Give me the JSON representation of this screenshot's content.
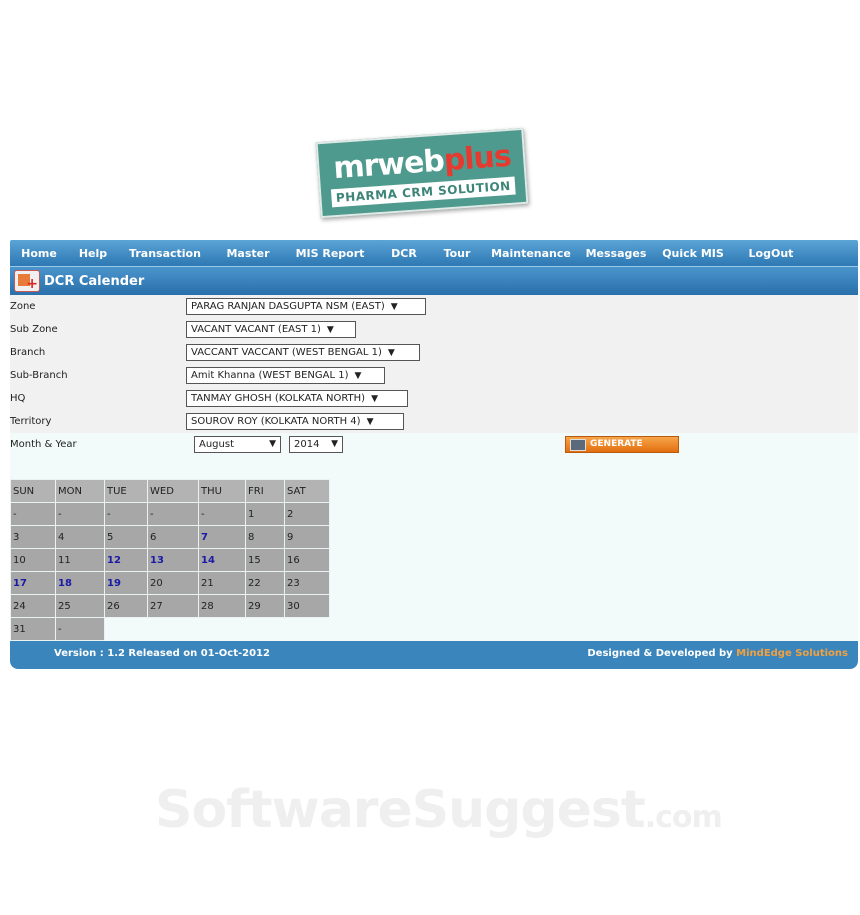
{
  "logo": {
    "word_main": "mrweb",
    "word_accent": "plus",
    "tagline": "PHARMA CRM SOLUTION"
  },
  "nav": [
    "Home",
    "Help",
    "Transaction",
    "Master",
    "MIS Report",
    "DCR",
    "Tour",
    "Maintenance",
    "Messages",
    "Quick MIS",
    "LogOut"
  ],
  "page_title": "DCR Calender",
  "form": {
    "zone": {
      "label": "Zone",
      "value": "PARAG RANJAN DASGUPTA NSM (EAST)"
    },
    "sub_zone": {
      "label": "Sub Zone",
      "value": "VACANT VACANT (EAST 1)"
    },
    "branch": {
      "label": "Branch",
      "value": "VACCANT VACCANT (WEST BENGAL 1)"
    },
    "sub_branch": {
      "label": "Sub-Branch",
      "value": "Amit Khanna (WEST BENGAL 1)"
    },
    "hq": {
      "label": "HQ",
      "value": "TANMAY GHOSH (KOLKATA NORTH)"
    },
    "territory": {
      "label": "Territory",
      "value": "SOUROV ROY (KOLKATA NORTH 4)"
    },
    "month_year": {
      "label": "Month & Year",
      "month": "August",
      "year": "2014"
    },
    "generate_label": "GENERATE",
    "arrow": "▼"
  },
  "calendar": {
    "headers": [
      "SUN",
      "MON",
      "TUE",
      "WED",
      "THU",
      "FRI",
      "SAT"
    ],
    "weeks": [
      [
        "-",
        "-",
        "-",
        "-",
        "-",
        "1",
        "2"
      ],
      [
        "3",
        "4",
        "5",
        "6",
        "7",
        "8",
        "9"
      ],
      [
        "10",
        "11",
        "12",
        "13",
        "14",
        "15",
        "16"
      ],
      [
        "17",
        "18",
        "19",
        "20",
        "21",
        "22",
        "23"
      ],
      [
        "24",
        "25",
        "26",
        "27",
        "28",
        "29",
        "30"
      ],
      [
        "31",
        "-"
      ]
    ],
    "highlighted": [
      "7",
      "12",
      "13",
      "14",
      "17",
      "18",
      "19"
    ],
    "highlight_color": "#1a1aa6"
  },
  "footer": {
    "version": "Version : 1.2 Released on 01-Oct-2012",
    "designed_by": "Designed & Developed by",
    "company": "MindEdge Solutions"
  },
  "watermark": {
    "main": "SoftwareSuggest",
    "suffix": ".com"
  }
}
